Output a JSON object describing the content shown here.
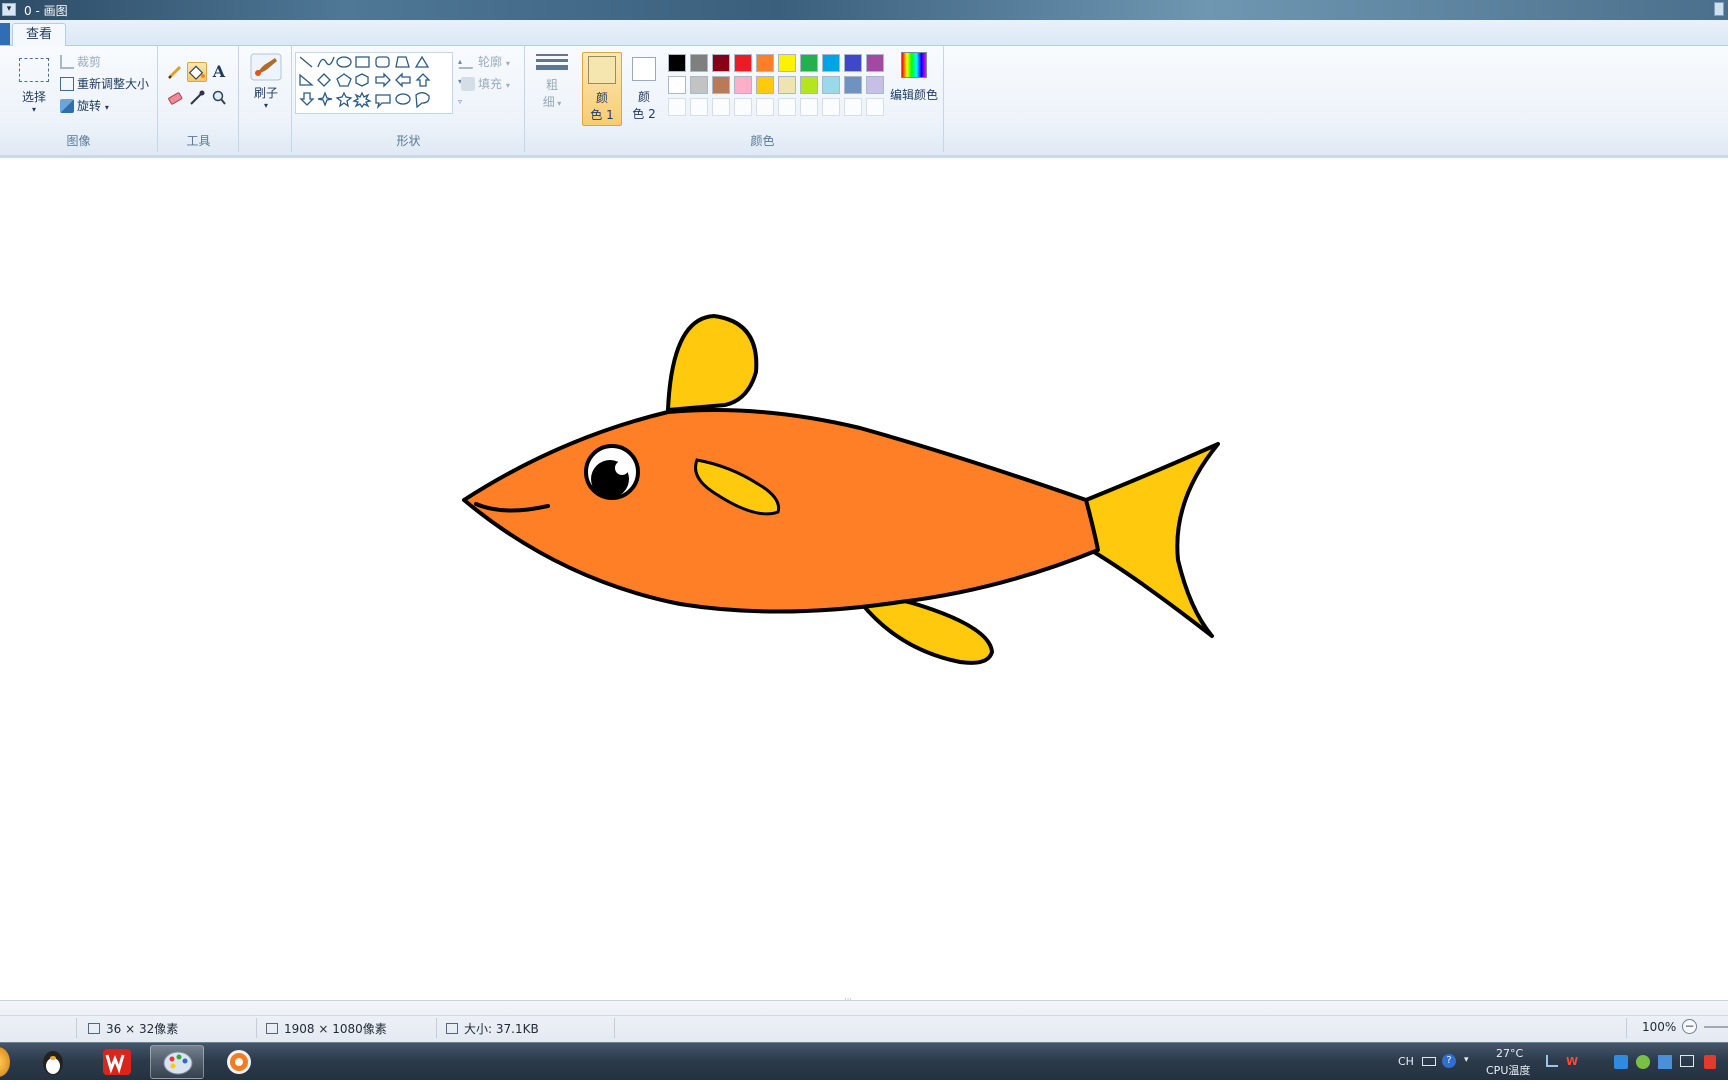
{
  "window": {
    "title": "0 - 画图",
    "system_menu_glyph": "▾"
  },
  "tabs": [
    {
      "label": "查看"
    }
  ],
  "ribbon": {
    "image_group": {
      "label": "图像",
      "select_label": "选择",
      "crop_label": "裁剪",
      "resize_label": "重新调整大小",
      "rotate_label": "旋转"
    },
    "tools_group": {
      "label": "工具",
      "text_glyph": "A"
    },
    "brushes": {
      "label": "刷子"
    },
    "shapes_group": {
      "label": "形状",
      "outline_label": "轮廓",
      "fill_label": "填充"
    },
    "size": {
      "label_1": "粗",
      "label_2": "细"
    },
    "colors_group": {
      "label": "颜色",
      "color1_line1": "颜",
      "color1_line2": "色 1",
      "color2_line1": "颜",
      "color2_line2": "色 2",
      "color1_value": "#f5e6b0",
      "color2_value": "#ffffff",
      "edit_colors_label": "编辑颜色",
      "palette_row1": [
        "#000000",
        "#7f7f7f",
        "#880015",
        "#ed1c24",
        "#ff7f27",
        "#fff200",
        "#22b14c",
        "#00a2e8",
        "#3f48cc",
        "#a349a4"
      ],
      "palette_row2": [
        "#ffffff",
        "#c3c3c3",
        "#b97a57",
        "#ffaec9",
        "#ffc90e",
        "#efe4b0",
        "#b5e61d",
        "#99d9ea",
        "#7092be",
        "#c8bfe7"
      ]
    }
  },
  "canvas": {
    "fish_colors": {
      "body": "#ff7f27",
      "fins": "#ffc90e",
      "outline": "#000000",
      "eye_white": "#ffffff",
      "pupil": "#000000"
    }
  },
  "statusbar": {
    "cursor_position": "36 × 32像素",
    "canvas_size": "1908 × 1080像素",
    "file_size": "大小: 37.1KB",
    "zoom": "100%",
    "zoom_out_glyph": "−",
    "resize_grip_glyph": "⁞⁞⁞"
  },
  "taskbar": {
    "tray_lang": "CH",
    "temperature": "27°C",
    "cpu_label": "CPU温度",
    "help_glyph": "?"
  }
}
